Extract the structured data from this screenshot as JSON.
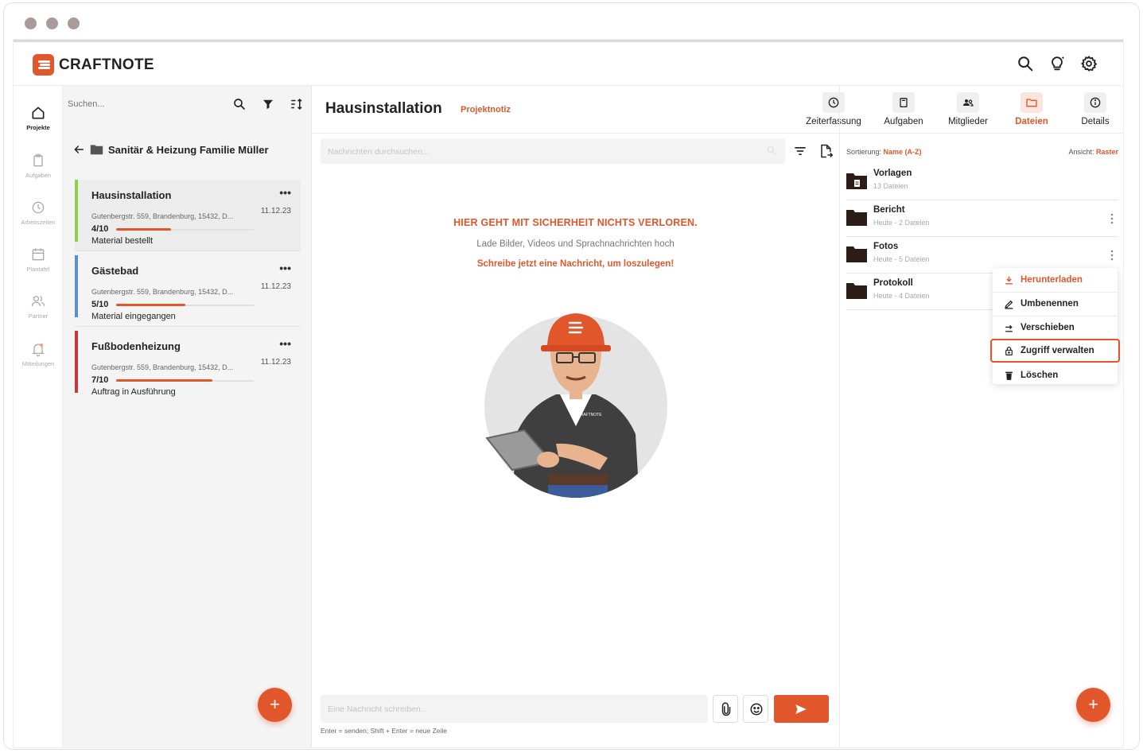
{
  "app": {
    "name": "CRAFTNOTE"
  },
  "rail": [
    {
      "label": "Projekte",
      "icon": "home-icon",
      "active": true
    },
    {
      "label": "Aufgaben",
      "icon": "clipboard-icon"
    },
    {
      "label": "Arbeitszeiten",
      "icon": "clock-icon"
    },
    {
      "label": "Plantafel",
      "icon": "calendar-icon"
    },
    {
      "label": "Partner",
      "icon": "people-icon"
    },
    {
      "label": "Mitteilungen",
      "icon": "bell-icon"
    }
  ],
  "list": {
    "search_placeholder": "Suchen...",
    "folder": "Sanitär & Heizung Familie Müller",
    "projects": [
      {
        "name": "Hausinstallation",
        "date": "11.12.23",
        "address": "Gutenbergstr. 559, Brandenburg, 15432, D...",
        "progress_label": "4/10",
        "progress": 0.4,
        "status": "Material bestellt",
        "color": "#8dd14a",
        "more": "•••"
      },
      {
        "name": "Gästebad",
        "date": "11.12.23",
        "address": "Gutenbergstr. 559, Brandenburg, 15432, D...",
        "progress_label": "5/10",
        "progress": 0.5,
        "status": "Material eingegangen",
        "color": "#5b8fd6",
        "more": "•••"
      },
      {
        "name": "Fußbodenheizung",
        "date": "11.12.23",
        "address": "Gutenbergstr. 559, Brandenburg, 15432, D...",
        "progress_label": "7/10",
        "progress": 0.7,
        "status": "Auftrag in Ausführung",
        "color": "#c9373d",
        "more": "•••"
      }
    ],
    "fab": "+"
  },
  "chat": {
    "title": "Hausinstallation",
    "tag": "Projektnotiz",
    "search_placeholder": "Nachrichten durchsuchen...",
    "empty_title": "HIER GEHT MIT SICHERHEIT NICHTS VERLOREN.",
    "empty_sub": "Lade Bilder, Videos und Sprachnachrichten hoch",
    "empty_cta": "Schreibe jetzt eine Nachricht, um loszulegen!",
    "compose_placeholder": "Eine Nachricht schreiben...",
    "hint": "Enter = senden; Shift + Enter = neue Zeile",
    "mascot_shirt_text": "CRAFTNOTE"
  },
  "tabs": [
    {
      "label": "Zeiterfassung",
      "icon": "clock-icon"
    },
    {
      "label": "Aufgaben",
      "icon": "clipboard-icon"
    },
    {
      "label": "Mitglieder",
      "icon": "members-icon"
    },
    {
      "label": "Dateien",
      "icon": "folder-icon",
      "active": true
    },
    {
      "label": "Details",
      "icon": "info-icon"
    }
  ],
  "files": {
    "sort_label": "Sortierung:",
    "sort_value": "Name (A-Z)",
    "view_label": "Ansicht:",
    "view_value": "Raster",
    "items": [
      {
        "name": "Vorlagen",
        "meta": "13 Dateien",
        "kind": "template"
      },
      {
        "name": "Bericht",
        "meta": "Heute - 2 Dateien",
        "kind": "folder"
      },
      {
        "name": "Fotos",
        "meta": "Heute - 5 Dateien",
        "kind": "folder"
      },
      {
        "name": "Protokoll",
        "meta": "Heute - 4 Dateien",
        "kind": "folder"
      }
    ],
    "fab": "+"
  },
  "context_menu": [
    {
      "label": "Herunterladen",
      "icon": "download-icon"
    },
    {
      "label": "Umbenennen",
      "icon": "pencil-icon"
    },
    {
      "label": "Verschieben",
      "icon": "move-icon"
    },
    {
      "label": "Zugriff verwalten",
      "icon": "lock-icon",
      "selected": true
    },
    {
      "label": "Löschen",
      "icon": "trash-icon"
    }
  ],
  "colors": {
    "accent": "#e2562b",
    "rail_text": "#aaaaaa"
  }
}
